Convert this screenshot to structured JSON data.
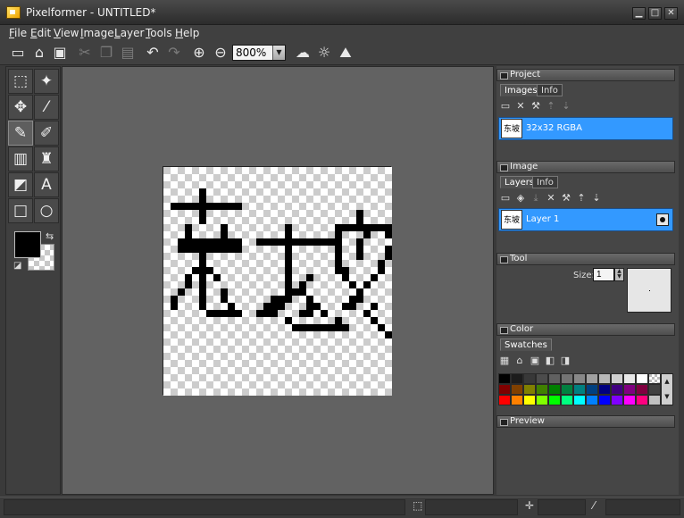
{
  "window": {
    "title": "Pixelformer - UNTITLED*",
    "minimize": "▁",
    "maximize": "□",
    "close": "✕"
  },
  "menu": [
    "File",
    "Edit",
    "View",
    "Image",
    "Layer",
    "Tools",
    "Help"
  ],
  "toolbar": {
    "icons": [
      "new-icon",
      "open-icon",
      "save-icon",
      "cut-icon",
      "copy-icon",
      "paste-icon",
      "undo-icon",
      "redo-icon",
      "zoom-in-icon",
      "zoom-out-icon",
      "weather-icon",
      "brightness-icon",
      "adjust-icon"
    ],
    "zoom": "800%"
  },
  "tools": {
    "icons": [
      "rect-select-icon",
      "magic-wand-icon",
      "move-icon",
      "eyedropper-icon",
      "pencil-icon",
      "brush-icon",
      "gradient-icon",
      "stamp-icon",
      "eraser-icon",
      "text-icon",
      "rectangle-icon",
      "ellipse-icon"
    ],
    "foreground_color": "#000000"
  },
  "canvas": {
    "image_width": 32,
    "image_height": 32,
    "black_pixel_rows": [
      [],
      [],
      [],
      [
        5
      ],
      [
        5
      ],
      [
        1,
        2,
        3,
        4,
        5,
        6,
        7,
        8,
        9,
        10
      ],
      [
        5,
        27
      ],
      [
        5,
        27
      ],
      [
        3,
        8,
        17,
        24,
        25,
        26,
        27,
        28,
        29,
        30,
        31
      ],
      [
        3,
        8,
        17,
        24,
        28,
        31
      ],
      [
        2,
        3,
        4,
        5,
        6,
        7,
        8,
        9,
        10,
        13,
        14,
        15,
        16,
        17,
        18,
        19,
        20,
        21,
        22,
        23,
        24,
        27
      ],
      [
        2,
        3,
        4,
        5,
        6,
        7,
        8,
        9,
        10,
        17,
        24,
        27,
        31
      ],
      [
        5,
        17,
        24,
        27,
        31
      ],
      [
        5,
        17,
        24,
        30
      ],
      [
        4,
        5,
        6,
        17,
        24,
        25,
        30
      ],
      [
        3,
        5,
        7,
        17,
        20,
        25,
        29
      ],
      [
        3,
        5,
        17,
        19,
        26,
        28
      ],
      [
        2,
        5,
        8,
        17,
        18,
        19,
        27
      ],
      [
        1,
        5,
        8,
        15,
        16,
        17,
        20,
        26,
        27
      ],
      [
        1,
        5,
        9,
        14,
        15,
        16,
        20,
        21,
        25,
        26,
        29
      ],
      [
        6,
        7,
        8,
        9,
        10,
        13,
        14,
        15,
        19,
        20,
        22,
        28
      ],
      [
        17,
        24,
        29
      ],
      [
        18,
        19,
        20,
        21,
        22,
        23,
        24,
        25,
        30
      ],
      [
        31
      ],
      [],
      [],
      [],
      [],
      [],
      [],
      [],
      []
    ]
  },
  "panels": {
    "project": {
      "title": "Project",
      "tabs": [
        "Images",
        "Info"
      ],
      "tools": [
        "new-image-icon",
        "delete-icon",
        "properties-icon",
        "move-up-icon",
        "move-down-icon"
      ],
      "items": [
        {
          "thumb": "东坡",
          "label": "32x32 RGBA"
        }
      ]
    },
    "image": {
      "title": "Image",
      "tabs": [
        "Layers",
        "Info"
      ],
      "tools": [
        "new-layer-icon",
        "layer-stack-icon",
        "merge-icon",
        "delete-icon",
        "properties-icon",
        "move-up-icon",
        "move-down-icon"
      ],
      "items": [
        {
          "thumb": "东坡",
          "label": "Layer 1"
        }
      ]
    },
    "tool": {
      "title": "Tool",
      "size_label": "Size:",
      "size_value": "1"
    },
    "color": {
      "title": "Color",
      "tabs": [
        "Swatches"
      ],
      "tools": [
        "grid-icon",
        "open-palette-icon",
        "save-palette-icon",
        "copy-color-icon",
        "paste-color-icon"
      ],
      "palette_row1": [
        "#000000",
        "#1c1c1c",
        "#383838",
        "#4c4c4c",
        "#606060",
        "#747474",
        "#888888",
        "#a0a0a0",
        "#b8b8b8",
        "#d0d0d0",
        "#e8e8e8",
        "#ffffff",
        "transparent"
      ],
      "palette_row2": [
        "#800000",
        "#804000",
        "#808000",
        "#408000",
        "#008000",
        "#008040",
        "#008080",
        "#004080",
        "#000080",
        "#400080",
        "#800080",
        "#800040",
        "#404040"
      ],
      "palette_row3": [
        "#ff0000",
        "#ff8000",
        "#ffff00",
        "#80ff00",
        "#00ff00",
        "#00ff80",
        "#00ffff",
        "#0080ff",
        "#0000ff",
        "#8000ff",
        "#ff00ff",
        "#ff0080",
        "#c0c0c0"
      ]
    },
    "preview": {
      "title": "Preview"
    }
  }
}
